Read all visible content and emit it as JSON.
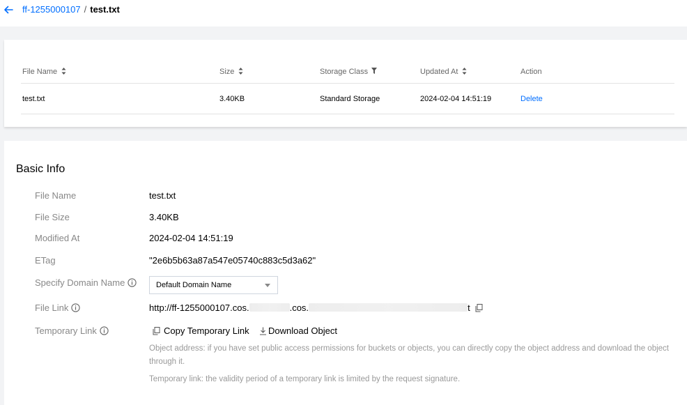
{
  "breadcrumb": {
    "bucket": "ff-1255000107",
    "separator": "/",
    "file": "test.txt"
  },
  "file_table": {
    "headers": {
      "file_name": "File Name",
      "size": "Size",
      "storage_class": "Storage Class",
      "updated_at": "Updated At",
      "action": "Action"
    },
    "row": {
      "file_name": "test.txt",
      "size": "3.40KB",
      "storage_class": "Standard Storage",
      "updated_at": "2024-02-04 14:51:19",
      "action": "Delete"
    }
  },
  "basic_info": {
    "title": "Basic Info",
    "labels": {
      "file_name": "File Name",
      "file_size": "File Size",
      "modified_at": "Modified At",
      "etag": "ETag",
      "domain": "Specify Domain Name",
      "file_link": "File Link",
      "temp_link": "Temporary Link"
    },
    "values": {
      "file_name": "test.txt",
      "file_size": "3.40KB",
      "modified_at": "2024-02-04 14:51:19",
      "etag": "\"2e6b5b63a87a547e05740c883c5d3a62\""
    },
    "domain_select": {
      "selected": "Default Domain Name"
    },
    "file_link": {
      "part1": "http://ff-1255000107.cos.",
      "part2": ".cos.",
      "part3": "t"
    },
    "actions": {
      "copy_temp": "Copy Temporary Link",
      "download": "Download Object"
    },
    "notes": {
      "object_address": "Object address: if you have set public access permissions for buckets or objects, you can directly copy the object address and download the object through it.",
      "temp_link": "Temporary link: the validity period of a temporary link is limited by the request signature."
    }
  },
  "colors": {
    "accent": "#006eff",
    "background": "#f2f3f5",
    "label": "#888888",
    "note": "#999999"
  },
  "icons": [
    "back-arrow-icon",
    "sort-icon",
    "filter-icon",
    "info-icon",
    "chevron-down-icon",
    "copy-icon",
    "download-icon"
  ]
}
